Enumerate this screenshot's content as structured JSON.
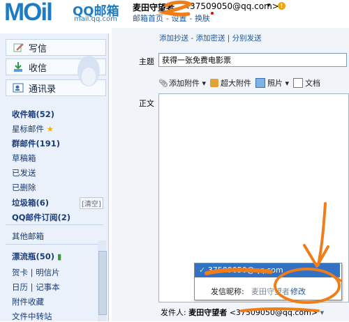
{
  "header": {
    "logo_mark": "MOil",
    "logo_qq": "QQ邮箱",
    "logo_url": "mail.qq.com",
    "user_name": "麦田守望者",
    "user_email": "<37509050@qq.com>",
    "account_caret": "▾",
    "info_icon": "!",
    "links": [
      "邮箱首页",
      "设置",
      "换肤"
    ]
  },
  "top_buttons": [
    {
      "label": "写信",
      "icon": "compose-icon"
    },
    {
      "label": "收信",
      "icon": "inbox-download-icon"
    },
    {
      "label": "通讯录",
      "icon": "contacts-icon"
    }
  ],
  "folders": {
    "inbox": "收件箱(52)",
    "starred": "星标邮件",
    "group": "群邮件(191)",
    "drafts": "草稿箱",
    "sent": "已发送",
    "deleted": "已删除",
    "spam": "垃圾箱(6)",
    "spam_clear": "[清空]",
    "subscriptions": "QQ邮件订阅(2)",
    "other": "其他邮箱",
    "drift": "漂流瓶(50)",
    "cards": "贺卡",
    "postcards": "明信片",
    "calendar": "日历",
    "notebook": "记事本",
    "attachments": "附件收藏",
    "transfer": "文件中转站",
    "separator": "|"
  },
  "compose": {
    "links": "添加抄送 - 添加密送 | 分别发送",
    "subject_label": "主题",
    "subject_value": "获得一张免费电影票",
    "toolbar": [
      "添加附件",
      "超大附件",
      "照片",
      "文档"
    ],
    "body_label": "正文",
    "sender_label": "发件人:",
    "sender_name": "麦田守望者",
    "sender_email": "<37509050@qq.com>"
  },
  "dropdown": {
    "selected": "37509050@qq.com",
    "nick_label": "发信昵称:",
    "nick_value": "麦田守望者",
    "edit_link": "修改"
  },
  "colors": {
    "brand_blue": "#1d7cc4",
    "annotation_orange": "#ef7d1a",
    "selected_blue": "#3271c4"
  }
}
